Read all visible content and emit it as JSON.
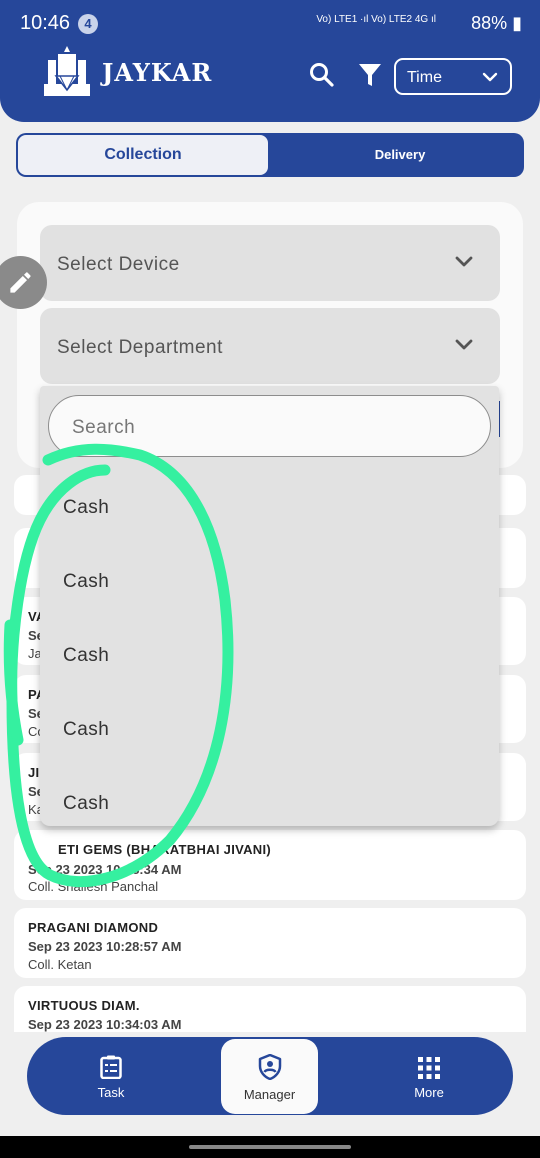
{
  "status_bar": {
    "time": "10:46",
    "notification_count": "4",
    "network": "Vo) LTE1 ·ıl Vo) LTE2 4G ıl",
    "battery": "88%"
  },
  "header": {
    "brand": "JAYKAR",
    "time_filter": "Time"
  },
  "tabs": {
    "active": "Collection",
    "other": "Delivery"
  },
  "filters": {
    "device_placeholder": "Select Device",
    "department_placeholder": "Select Department"
  },
  "dropdown": {
    "search_placeholder": "Search",
    "items": [
      "Cash",
      "Cash",
      "Cash",
      "Cash",
      "Cash"
    ]
  },
  "list": {
    "partial_visible": [
      {
        "title": "VA",
        "line2": "Se",
        "line3": "Ja"
      },
      {
        "title": "PA",
        "line2": "Se",
        "line3": "Co"
      },
      {
        "title": "JI",
        "line2": "Se",
        "line3": "Ka"
      }
    ],
    "items": [
      {
        "title": "ETI GEMS (BHARATBHAI JIVANI)",
        "date": "Sep 23 2023 10:28:34 AM",
        "coll": "Coll. Shailesh Panchal"
      },
      {
        "title": "PRAGANI DIAMOND",
        "date": "Sep 23 2023 10:28:57 AM",
        "coll": "Coll. Ketan"
      },
      {
        "title": "VIRTUOUS DIAM.",
        "date": "Sep 23 2023 10:34:03 AM",
        "coll": ""
      }
    ]
  },
  "bottom_nav": {
    "task": "Task",
    "manager": "Manager",
    "more": "More"
  },
  "colors": {
    "primary": "#26479a",
    "highlight_annotation": "#35f0a0"
  }
}
